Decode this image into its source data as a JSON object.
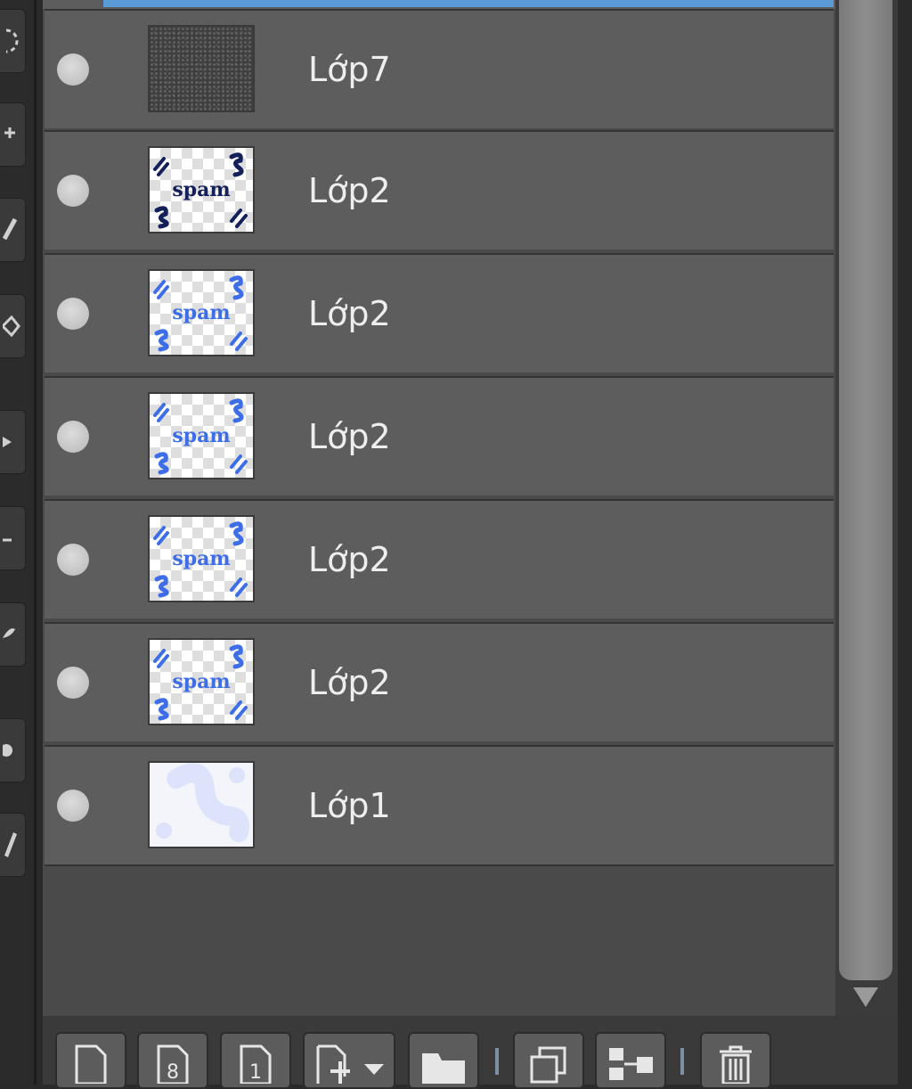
{
  "layers": [
    {
      "name": "Lớp7",
      "thumbnail": "noise-texture"
    },
    {
      "name": "Lớp2",
      "thumbnail": "spam-dark-navy"
    },
    {
      "name": "Lớp2",
      "thumbnail": "spam-blue"
    },
    {
      "name": "Lớp2",
      "thumbnail": "spam-blue"
    },
    {
      "name": "Lớp2",
      "thumbnail": "spam-blue"
    },
    {
      "name": "Lớp2",
      "thumbnail": "spam-blue"
    },
    {
      "name": "Lớp1",
      "thumbnail": "pale-shapes"
    }
  ],
  "thumb_text": "spam",
  "colors": {
    "selection": "#5b9bd5",
    "panel": "#4a4a4a",
    "row": "#5d5d5d",
    "text": "#eeeeee",
    "navy": "#14205a",
    "blue": "#3d6ee8"
  },
  "toolbar": {
    "new_raster_icon": "new-raster-layer-icon",
    "new_8bit_icon": "new-8bit-layer-icon",
    "new_1bit_icon": "new-1bit-layer-icon",
    "new_layer_menu_icon": "new-layer-dropdown-icon",
    "new_folder_icon": "new-folder-icon",
    "duplicate_icon": "duplicate-layer-icon",
    "merge_icon": "merge-down-icon",
    "delete_icon": "trash-icon",
    "btn_8_label": "8",
    "btn_1_label": "1"
  }
}
